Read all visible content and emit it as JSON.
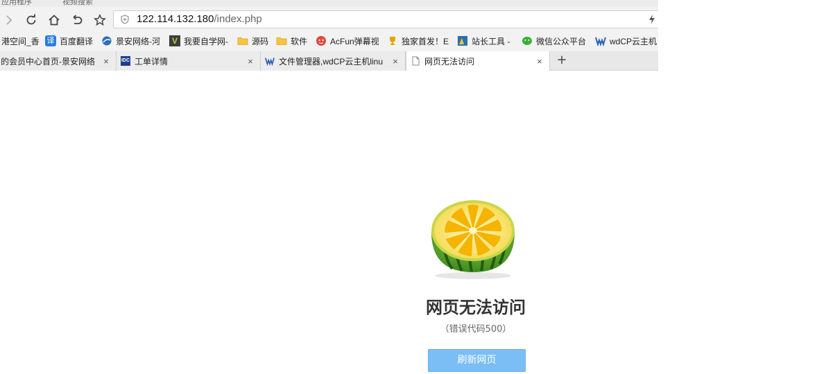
{
  "top_strip": {
    "left_text": "应用程序",
    "right_text": "视频搜索"
  },
  "address_bar": {
    "host": "122.114.132.180",
    "path": "/index.php"
  },
  "bookmarks": [
    {
      "label": "港空间_香",
      "icon": "page-icon",
      "color": "#4a90d9"
    },
    {
      "label": "百度翻译",
      "icon": "translate-icon",
      "color": "#2a7de1"
    },
    {
      "label": "景安网络-河",
      "icon": "globe-icon",
      "color": "#2e6fb8"
    },
    {
      "label": "我要自学网-",
      "icon": "v-logo-icon",
      "color": "#6b8e23"
    },
    {
      "label": "源码",
      "icon": "folder-icon",
      "color": "#f5c542"
    },
    {
      "label": "软件",
      "icon": "folder-icon",
      "color": "#f5c542"
    },
    {
      "label": "AcFun弹幕视",
      "icon": "acfun-icon",
      "color": "#e0463c"
    },
    {
      "label": "独家首发！E",
      "icon": "trophy-icon",
      "color": "#e7a400"
    },
    {
      "label": "站长工具 -",
      "icon": "chart-logo-icon",
      "color": "#2a6fb0"
    },
    {
      "label": "微信公众平台",
      "icon": "wechat-icon",
      "color": "#3cb035"
    },
    {
      "label": "wdCP云主机",
      "icon": "wdcp-icon",
      "color": "#2b5fb4"
    }
  ],
  "tabs": [
    {
      "title": "的会员中心首页-景安网络",
      "icon": "none",
      "active": false
    },
    {
      "title": "工单详情",
      "icon": "idc-icon",
      "active": false
    },
    {
      "title": "文件管理器,wdCP云主机linu",
      "icon": "wdcp-icon",
      "active": false
    },
    {
      "title": "网页无法访问",
      "icon": "page-icon",
      "active": true
    }
  ],
  "tab_close": "×",
  "new_tab": "+",
  "error": {
    "title": "网页无法访问",
    "code_text": "（错误代码500）",
    "button_label": "刷新网页"
  }
}
